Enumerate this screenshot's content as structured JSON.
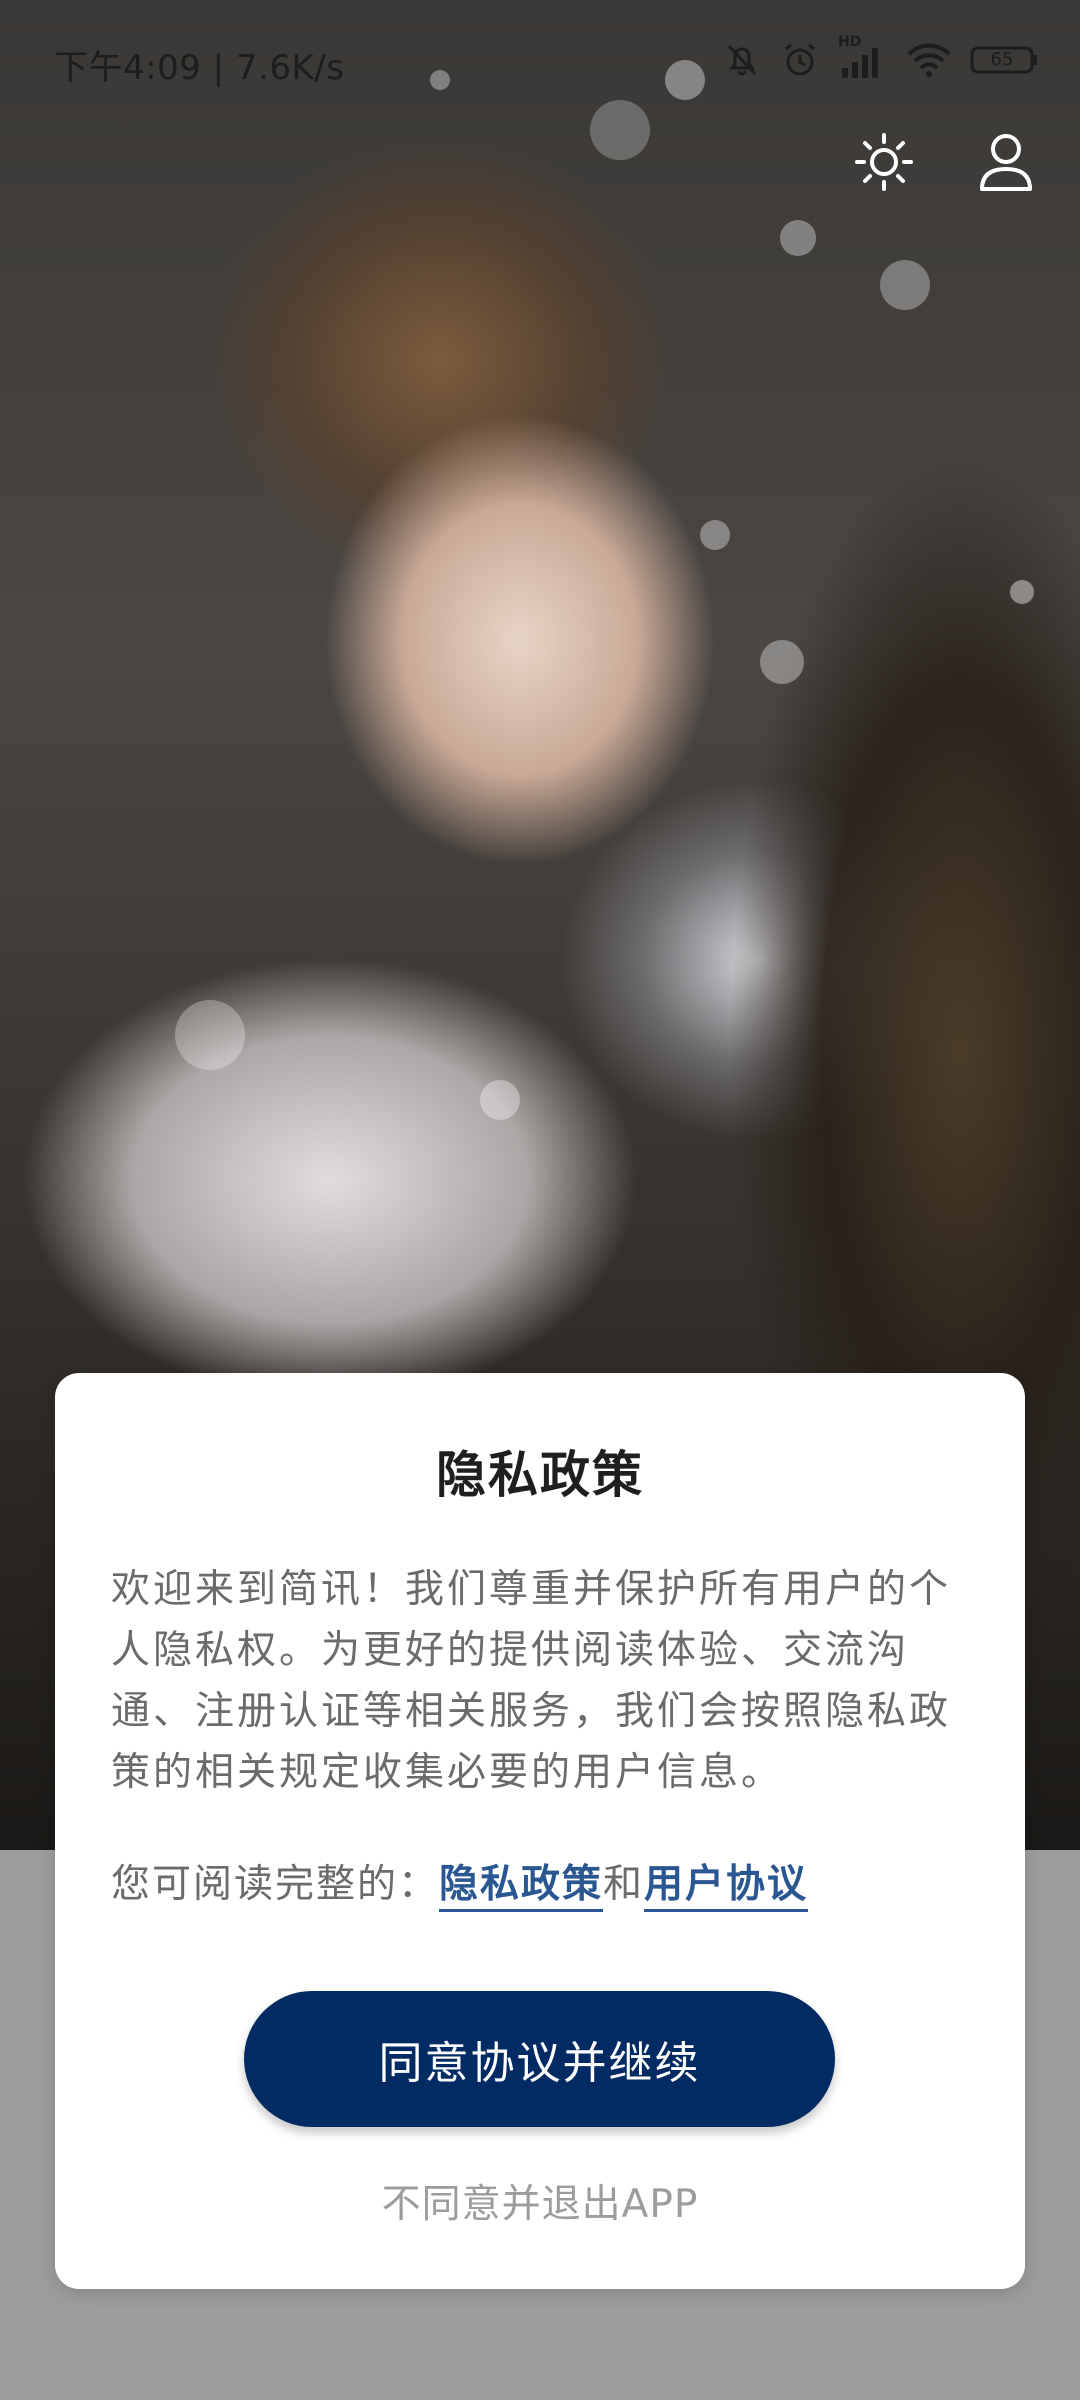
{
  "status_bar": {
    "time": "下午4:09 | 7.6K/s",
    "battery": "65",
    "network_badge": "HD"
  },
  "top_actions": {
    "icons": [
      "brightness-icon",
      "user-icon"
    ]
  },
  "dialog": {
    "title": "隐私政策",
    "body": "欢迎来到简讯！我们尊重并保护所有用户的个人隐私权。为更好的提供阅读体验、交流沟通、注册认证等相关服务，我们会按照隐私政策的相关规定收集必要的用户信息。",
    "links_prefix": "您可阅读完整的：",
    "privacy_link": "隐私政策",
    "and_text": "和",
    "user_agreement_link": "用户协议",
    "agree_button": "同意协议并继续",
    "disagree_button": "不同意并退出APP"
  },
  "colors": {
    "accent": "#032b63",
    "link": "#2a5792",
    "bottom_background": "#9d9d9d"
  }
}
